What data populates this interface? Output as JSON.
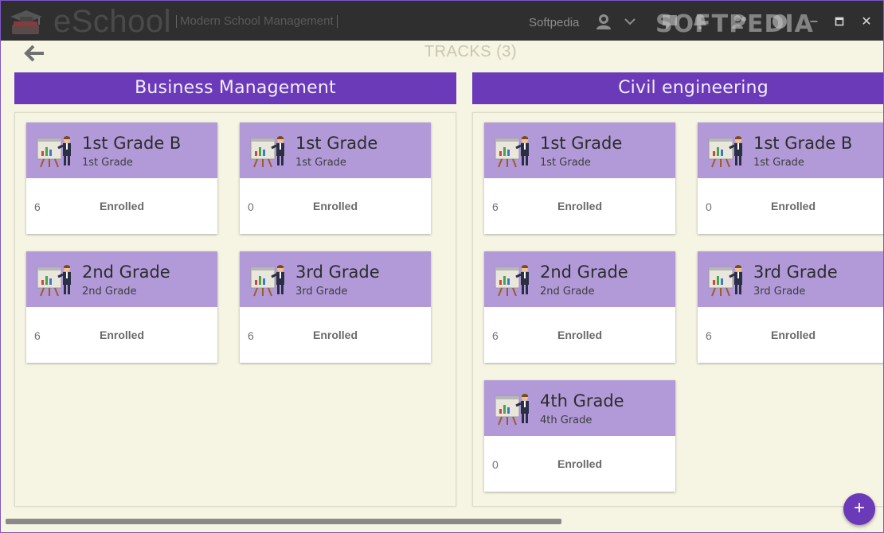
{
  "app": {
    "name": "eSchool",
    "subtitle": "Modern School Management",
    "user": "Softpedia",
    "watermark": "SOFTPEDIA"
  },
  "window_controls": {
    "minimize": "–",
    "maximize": "▫",
    "close": "✕"
  },
  "page": {
    "title": "TRACKS (3)"
  },
  "tracks": [
    {
      "name": "Business Management",
      "cards": [
        {
          "title": "1st Grade B",
          "subtitle": "1st Grade",
          "count": "6",
          "label": "Enrolled"
        },
        {
          "title": "1st Grade",
          "subtitle": "1st Grade",
          "count": "0",
          "label": "Enrolled"
        },
        {
          "title": "2nd Grade",
          "subtitle": "2nd Grade",
          "count": "6",
          "label": "Enrolled"
        },
        {
          "title": "3rd Grade",
          "subtitle": "3rd Grade",
          "count": "6",
          "label": "Enrolled"
        }
      ]
    },
    {
      "name": "Civil engineering",
      "cards": [
        {
          "title": "1st Grade",
          "subtitle": "1st Grade",
          "count": "6",
          "label": "Enrolled"
        },
        {
          "title": "1st Grade B",
          "subtitle": "1st Grade",
          "count": "0",
          "label": "Enrolled"
        },
        {
          "title": "2nd Grade",
          "subtitle": "2nd Grade",
          "count": "6",
          "label": "Enrolled"
        },
        {
          "title": "3rd Grade",
          "subtitle": "3rd Grade",
          "count": "6",
          "label": "Enrolled"
        },
        {
          "title": "4th Grade",
          "subtitle": "4th Grade",
          "count": "0",
          "label": "Enrolled"
        }
      ]
    }
  ],
  "fab": {
    "label": "+"
  },
  "colors": {
    "accent": "#6a3ab9",
    "card_header": "#b29ad9",
    "background": "#f6f4e2",
    "titlebar": "#2f2f2f"
  }
}
